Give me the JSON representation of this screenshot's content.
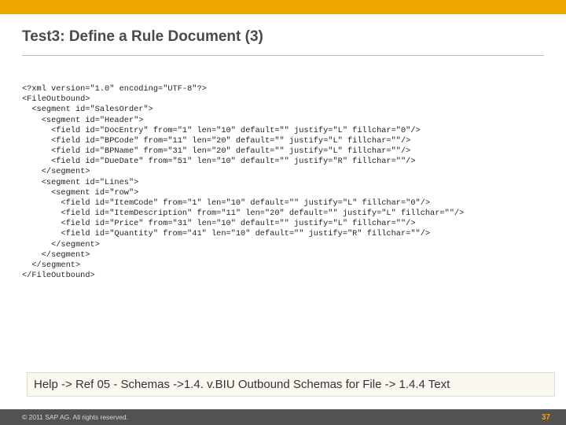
{
  "title": "Test3: Define a Rule Document (3)",
  "code": "<?xml version=\"1.0\" encoding=\"UTF-8\"?>\n<FileOutbound>\n  <segment id=\"SalesOrder\">\n    <segment id=\"Header\">\n      <field id=\"DocEntry\" from=\"1\" len=\"10\" default=\"\" justify=\"L\" fillchar=\"0\"/>\n      <field id=\"BPCode\" from=\"11\" len=\"20\" default=\"\" justify=\"L\" fillchar=\"\"/>\n      <field id=\"BPName\" from=\"31\" len=\"20\" default=\"\" justify=\"L\" fillchar=\"\"/>\n      <field id=\"DueDate\" from=\"51\" len=\"10\" default=\"\" justify=\"R\" fillchar=\"\"/>\n    </segment>\n    <segment id=\"Lines\">\n      <segment id=\"row\">\n        <field id=\"ItemCode\" from=\"1\" len=\"10\" default=\"\" justify=\"L\" fillchar=\"0\"/>\n        <field id=\"ItemDescription\" from=\"11\" len=\"20\" default=\"\" justify=\"L\" fillchar=\"\"/>\n        <field id=\"Price\" from=\"31\" len=\"10\" default=\"\" justify=\"L\" fillchar=\"\"/>\n        <field id=\"Quantity\" from=\"41\" len=\"10\" default=\"\" justify=\"R\" fillchar=\"\"/>\n      </segment>\n    </segment>\n  </segment>\n</FileOutbound>",
  "help": "Help -> Ref 05 - Schemas ->1.4. v.BIU Outbound Schemas for File -> 1.4.4 Text",
  "footer": {
    "copyright": "© 2011 SAP AG. All rights reserved.",
    "page": "37"
  }
}
